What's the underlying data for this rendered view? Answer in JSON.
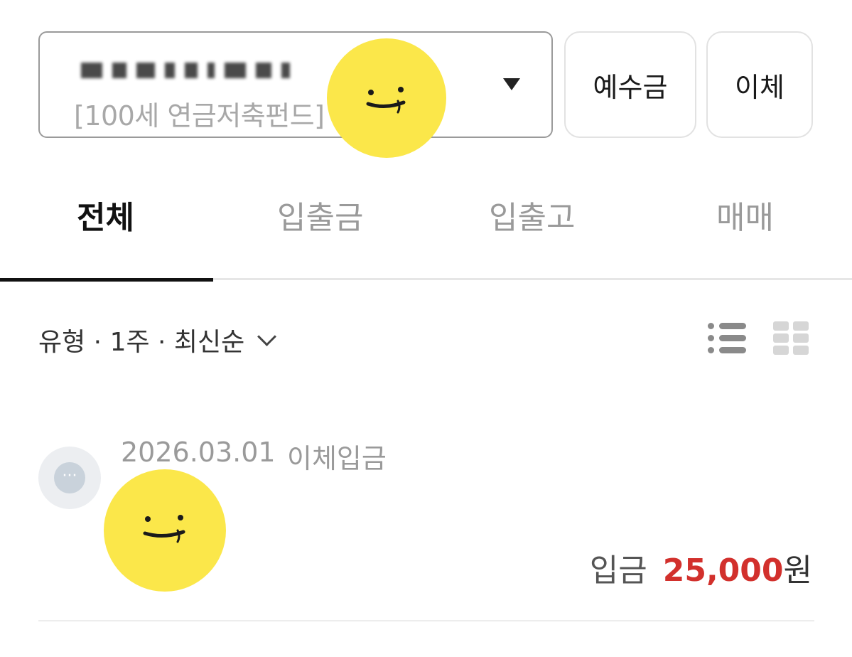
{
  "account": {
    "name": "[100세  연금저축펀드]"
  },
  "buttons": {
    "deposit_label": "예수금",
    "transfer_label": "이체"
  },
  "tabs": [
    {
      "label": "전체",
      "active": true
    },
    {
      "label": "입출금",
      "active": false
    },
    {
      "label": "입출고",
      "active": false
    },
    {
      "label": "매매",
      "active": false
    }
  ],
  "filter": {
    "label": "유형 · 1주 · 최신순"
  },
  "transaction": {
    "date": "2026.03.01",
    "type": "이체입금",
    "amount_label": "입금",
    "amount": "25,000",
    "currency": "원",
    "avatar_glyph": "···"
  },
  "colors": {
    "accent_red": "#d2302c",
    "sticker_yellow": "#fbe74a"
  }
}
